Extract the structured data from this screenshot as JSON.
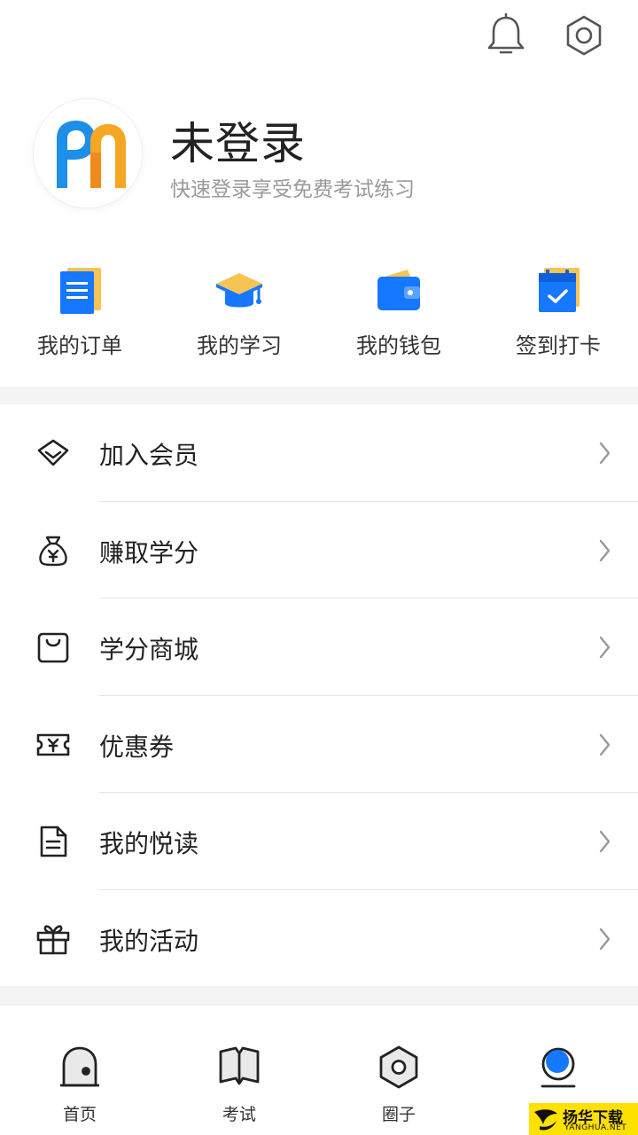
{
  "topbar": {
    "bell_icon": "bell-icon",
    "settings_icon": "settings-hexagon-icon"
  },
  "profile": {
    "avatar_icon": "app-logo-icon",
    "username": "未登录",
    "subtitle": "快速登录享受免费考试练习"
  },
  "quick_actions": [
    {
      "label": "我的订单",
      "icon": "orders-document-icon"
    },
    {
      "label": "我的学习",
      "icon": "graduation-cap-icon"
    },
    {
      "label": "我的钱包",
      "icon": "wallet-icon"
    },
    {
      "label": "签到打卡",
      "icon": "calendar-check-icon"
    }
  ],
  "menu": [
    {
      "label": "加入会员",
      "icon": "diamond-icon"
    },
    {
      "label": "赚取学分",
      "icon": "money-bag-icon"
    },
    {
      "label": "学分商城",
      "icon": "shopping-bag-icon"
    },
    {
      "label": "优惠券",
      "icon": "coupon-icon"
    },
    {
      "label": "我的悦读",
      "icon": "document-icon"
    },
    {
      "label": "我的活动",
      "icon": "gift-icon"
    }
  ],
  "tabbar": [
    {
      "label": "首页",
      "icon": "home-icon"
    },
    {
      "label": "考试",
      "icon": "book-icon"
    },
    {
      "label": "圈子",
      "icon": "circle-hexagon-icon"
    },
    {
      "label": "",
      "icon": "profile-dot-icon",
      "active": true
    }
  ],
  "watermark": {
    "cn": "扬华下载",
    "en": "YANGHUA.NET"
  },
  "colors": {
    "accent": "#1677ff",
    "text": "#222222",
    "muted": "#9a9a9a",
    "divider": "#e6e6e6",
    "gap": "#f4f4f4"
  }
}
